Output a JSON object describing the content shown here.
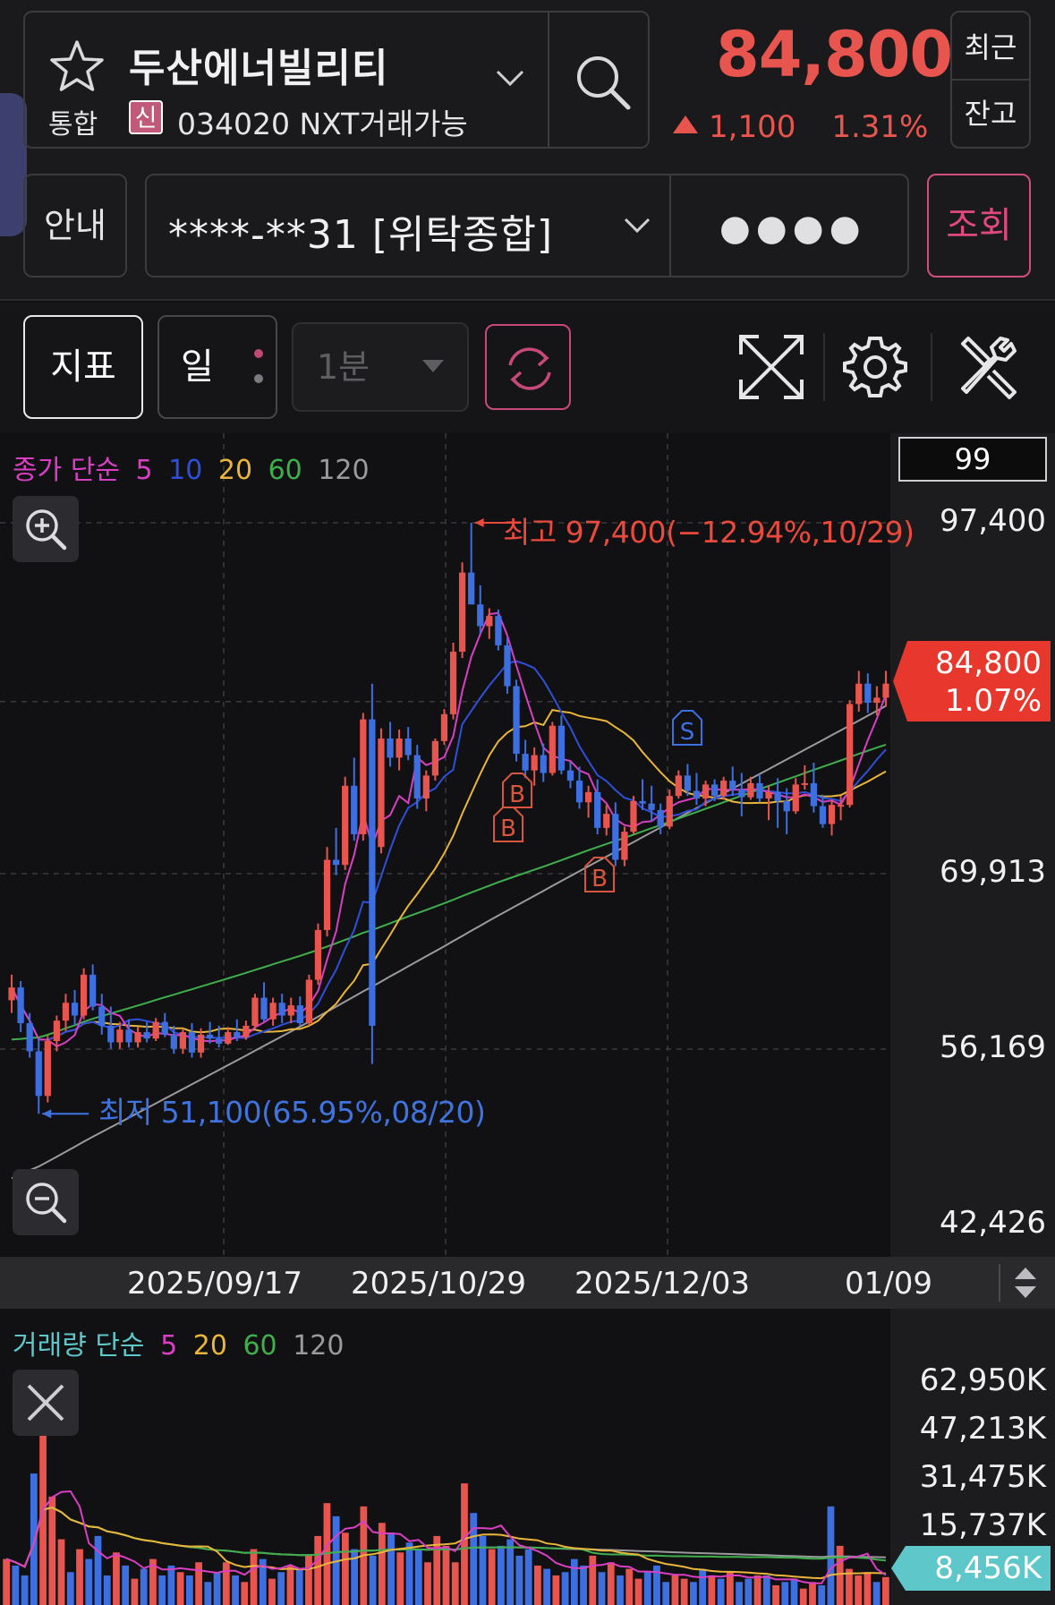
{
  "header": {
    "stock_name": "두산에너빌리티",
    "market": "통합",
    "credit_badge": "신",
    "code_line": "034020 NXT거래가능",
    "price": "84,800",
    "change_amount": "1,100",
    "change_percent": "1.31%",
    "recent_label": "최근",
    "balance_label": "잔고",
    "guide_label": "안내",
    "account": "****-**31 [위탁종합]",
    "password_mask": "●●●●",
    "query_label": "조회"
  },
  "toolbar": {
    "indicator_label": "지표",
    "period_label": "일",
    "minute_label": "1분"
  },
  "colors": {
    "up": "#e8544e",
    "down": "#3d6fe0",
    "ma5": "#d93fc3",
    "ma10": "#2f4fd8",
    "ma20": "#e9b53a",
    "ma60": "#3fae4c",
    "ma120": "#9a9a9e",
    "accent": "#d14d7a"
  },
  "price_chart": {
    "legend": {
      "prefix": "종가 단순",
      "ma5": "5",
      "ma10": "10",
      "ma20": "20",
      "ma60": "60",
      "ma120": "120"
    },
    "count_box": "99",
    "y_labels": [
      "97,400",
      "69,913",
      "56,169",
      "42,426"
    ],
    "current_price": "84,800",
    "current_pct": "1.07%",
    "high_annotation": "최고 97,400(−12.94%,10/29)",
    "low_annotation": "최저 51,100(65.95%,08/20)",
    "signal_labels": [
      "S",
      "B",
      "B",
      "B"
    ]
  },
  "date_axis": {
    "labels": [
      "2025/09/17",
      "2025/10/29",
      "2025/12/03",
      "01/09"
    ]
  },
  "volume_chart": {
    "legend": {
      "prefix": "거래량 단순",
      "ma5": "5",
      "ma20": "20",
      "ma60": "60",
      "ma120": "120"
    },
    "y_labels": [
      "62,950K",
      "47,213K",
      "31,475K",
      "15,737K"
    ],
    "current_volume": "8,456K"
  },
  "chart_data": [
    {
      "type": "candlestick",
      "title": "",
      "ylim": [
        42426,
        100000
      ],
      "y_ticks": [
        97400,
        69913,
        56169,
        42426
      ],
      "x_tick_labels": [
        "2025/09/17",
        "2025/10/29",
        "2025/12/03",
        "01/09"
      ],
      "high": {
        "value": 97400,
        "date": "10/29",
        "pct": -12.94
      },
      "low": {
        "value": 51100,
        "date": "08/20",
        "pct": 65.95
      },
      "last_close": 84800,
      "moving_averages": [
        "5",
        "10",
        "20",
        "60",
        "120"
      ],
      "candles": [
        [
          60000,
          62000,
          59000,
          61000
        ],
        [
          61000,
          61500,
          57500,
          58200
        ],
        [
          58200,
          59000,
          55500,
          56000
        ],
        [
          56000,
          57000,
          51100,
          52500
        ],
        [
          52500,
          57200,
          52000,
          56800
        ],
        [
          56800,
          58800,
          56000,
          58400
        ],
        [
          58400,
          60500,
          57600,
          59800
        ],
        [
          59800,
          60800,
          58000,
          58800
        ],
        [
          58800,
          62500,
          58500,
          62000
        ],
        [
          62000,
          62800,
          59200,
          59500
        ],
        [
          59500,
          60500,
          57300,
          58000
        ],
        [
          58000,
          59500,
          56200,
          56700
        ],
        [
          56700,
          58300,
          56200,
          57700
        ],
        [
          57700,
          58500,
          56300,
          56700
        ],
        [
          56700,
          57900,
          56300,
          57500
        ],
        [
          57500,
          58300,
          56700,
          57000
        ],
        [
          57000,
          58600,
          56800,
          58300
        ],
        [
          58300,
          59000,
          57100,
          57300
        ],
        [
          57300,
          58000,
          55800,
          56200
        ],
        [
          56200,
          57800,
          55800,
          57500
        ],
        [
          57500,
          58200,
          55500,
          55900
        ],
        [
          55900,
          57800,
          55500,
          57300
        ],
        [
          57300,
          58300,
          56600,
          57000
        ],
        [
          57000,
          58000,
          56300,
          56600
        ],
        [
          56600,
          57900,
          56500,
          57500
        ],
        [
          57500,
          58500,
          56800,
          57100
        ],
        [
          57100,
          58400,
          56900,
          58000
        ],
        [
          58000,
          60500,
          57800,
          60200
        ],
        [
          60200,
          61400,
          58300,
          58500
        ],
        [
          58500,
          60200,
          58000,
          59800
        ],
        [
          59800,
          60500,
          58200,
          58800
        ],
        [
          58800,
          60200,
          58200,
          59600
        ],
        [
          59600,
          60300,
          58000,
          58200
        ],
        [
          58200,
          62000,
          58000,
          61600
        ],
        [
          61600,
          66000,
          61200,
          65500
        ],
        [
          65500,
          72000,
          65000,
          71000
        ],
        [
          71000,
          73500,
          69800,
          70600
        ],
        [
          70600,
          77500,
          70200,
          76800
        ],
        [
          76800,
          79000,
          72500,
          73000
        ],
        [
          73000,
          82500,
          72500,
          82000
        ],
        [
          82000,
          84800,
          55000,
          58000
        ],
        [
          72000,
          81300,
          71500,
          80500
        ],
        [
          80500,
          81800,
          78300,
          79000
        ],
        [
          79000,
          81200,
          78000,
          80500
        ],
        [
          80500,
          81400,
          78800,
          79200
        ],
        [
          79200,
          80000,
          75000,
          75800
        ],
        [
          75800,
          78000,
          74800,
          77600
        ],
        [
          77600,
          80500,
          77200,
          80300
        ],
        [
          80300,
          82800,
          80000,
          82400
        ],
        [
          82400,
          88000,
          82000,
          87300
        ],
        [
          87300,
          94300,
          86800,
          93500
        ],
        [
          93500,
          97400,
          92200,
          91000
        ],
        [
          91000,
          92500,
          88700,
          89300
        ],
        [
          89300,
          90700,
          88300,
          90100
        ],
        [
          90100,
          90600,
          87400,
          87800
        ],
        [
          87800,
          88400,
          84000,
          84600
        ],
        [
          84600,
          85100,
          78700,
          79300
        ],
        [
          79300,
          80400,
          77400,
          78000
        ],
        [
          78000,
          79800,
          76800,
          79200
        ],
        [
          79200,
          80100,
          77100,
          77800
        ],
        [
          77800,
          81800,
          77600,
          81500
        ],
        [
          81500,
          82300,
          77700,
          78000
        ],
        [
          78000,
          78700,
          76600,
          77200
        ],
        [
          77200,
          78300,
          75000,
          75500
        ],
        [
          75500,
          76800,
          74300,
          76300
        ],
        [
          76300,
          77300,
          73000,
          73500
        ],
        [
          73500,
          75300,
          72900,
          74600
        ],
        [
          74600,
          75500,
          70500,
          71000
        ],
        [
          71000,
          73600,
          70500,
          73200
        ],
        [
          73200,
          76000,
          73000,
          75600
        ],
        [
          75600,
          77300,
          74900,
          75400
        ],
        [
          75400,
          76800,
          74000,
          74900
        ],
        [
          74900,
          75400,
          73000,
          73600
        ],
        [
          73600,
          76500,
          73400,
          76000
        ],
        [
          76000,
          78000,
          75800,
          77600
        ],
        [
          77600,
          78500,
          76000,
          76400
        ],
        [
          76400,
          77800,
          75300,
          75800
        ],
        [
          75800,
          77200,
          75200,
          76900
        ],
        [
          76900,
          77300,
          75600,
          76000
        ],
        [
          76000,
          77500,
          75700,
          77200
        ],
        [
          77200,
          78300,
          76000,
          76500
        ],
        [
          76500,
          77800,
          74400,
          75900
        ],
        [
          75900,
          77500,
          75700,
          77000
        ],
        [
          77000,
          77700,
          75500,
          75800
        ],
        [
          75800,
          76800,
          74100,
          76300
        ],
        [
          76300,
          77400,
          73500,
          75600
        ],
        [
          75600,
          76600,
          73000,
          74800
        ],
        [
          74800,
          77400,
          74600,
          76900
        ],
        [
          76900,
          78400,
          76500,
          77000
        ],
        [
          77000,
          78600,
          74700,
          75200
        ],
        [
          75200,
          76100,
          73500,
          73800
        ],
        [
          73800,
          75700,
          72900,
          75300
        ],
        [
          75300,
          76000,
          74100,
          75300
        ],
        [
          75300,
          83500,
          75100,
          83200
        ],
        [
          83200,
          85800,
          82600,
          84800
        ],
        [
          84800,
          85600,
          82500,
          83300
        ],
        [
          83300,
          84600,
          82300,
          83700
        ],
        [
          83700,
          85800,
          83000,
          84800
        ]
      ]
    },
    {
      "type": "bar",
      "title": "",
      "ylim": [
        0,
        70000
      ],
      "y_ticks": [
        62950,
        47213,
        31475,
        15737
      ],
      "unit": "K",
      "moving_averages": [
        "5",
        "20",
        "60",
        "120"
      ],
      "last_value": 8456,
      "values": [
        14000,
        12000,
        9000,
        40000,
        70000,
        33000,
        20000,
        10000,
        17000,
        14000,
        21000,
        9000,
        16000,
        12000,
        8000,
        11000,
        14000,
        9000,
        12000,
        10000,
        9000,
        13000,
        7000,
        10000,
        13000,
        9000,
        7000,
        17000,
        14000,
        8000,
        10000,
        12000,
        11000,
        15000,
        21000,
        31000,
        27000,
        22000,
        17000,
        30000,
        15000,
        25000,
        22000,
        16000,
        19000,
        17000,
        13000,
        21000,
        18000,
        13000,
        37000,
        28000,
        21000,
        17000,
        18000,
        20000,
        15000,
        17000,
        12000,
        11000,
        9000,
        10000,
        14000,
        12000,
        15000,
        10000,
        13000,
        9000,
        11000,
        8000,
        10000,
        12000,
        7000,
        9000,
        8000,
        7000,
        11000,
        9000,
        8000,
        10000,
        7000,
        8000,
        9000,
        9000,
        6000,
        7000,
        8000,
        5000,
        7000,
        6000,
        30000,
        18000,
        11000,
        9000,
        10000,
        7000,
        8500
      ]
    }
  ]
}
